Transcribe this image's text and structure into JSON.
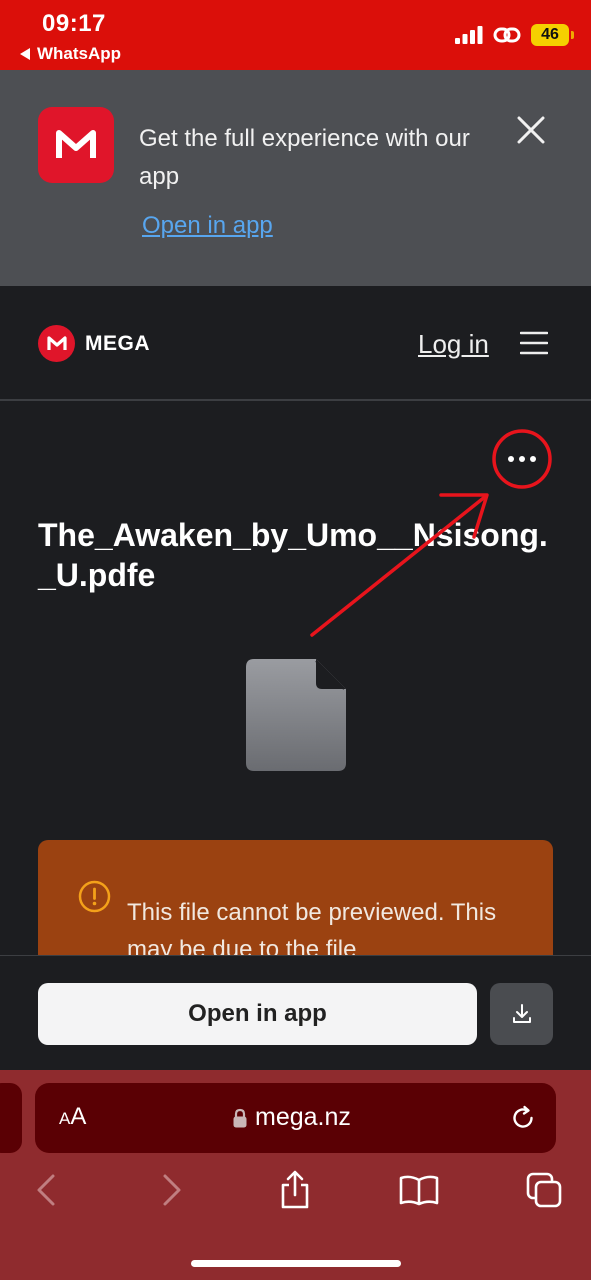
{
  "status_bar": {
    "time": "09:17",
    "back_app": "WhatsApp",
    "battery": "46",
    "icons": [
      "cellular-signal-icon",
      "personal-hotspot-icon",
      "battery-icon"
    ]
  },
  "app_banner": {
    "icon_letter": "M",
    "message": "Get the full experience with our app",
    "link": "Open in app"
  },
  "header": {
    "logo_letter": "M",
    "logo_text": "MEGA",
    "login": "Log in"
  },
  "file": {
    "name": "The_Awaken_by_Umo__Nsisong._U.pdfe",
    "warning": "This file cannot be previewed. This may be due to the file"
  },
  "actions": {
    "open_app": "Open in app"
  },
  "browser": {
    "aa_small": "A",
    "aa_large": "A",
    "url": "mega.nz"
  },
  "colors": {
    "status_red": "#db0f0a",
    "mega_red": "#e0152a",
    "banner_gray": "#4d4f53",
    "page_dark": "#1c1d20",
    "warning_orange": "#9b4211",
    "link_blue": "#58a6ef",
    "annotation_red": "#e8141c",
    "safari_red": "#8f2b2e"
  }
}
